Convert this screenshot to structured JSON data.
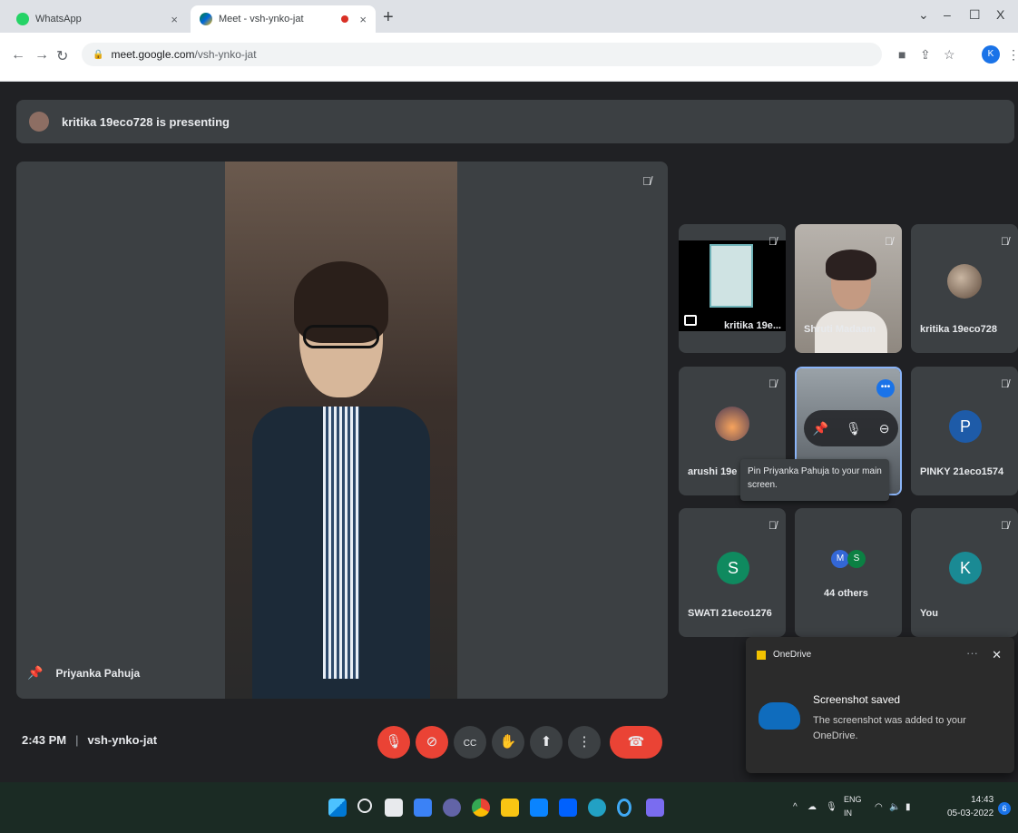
{
  "browser": {
    "tabs": [
      {
        "title": "WhatsApp",
        "close": "×"
      },
      {
        "title": "Meet - vsh-ynko-jat",
        "close": "×"
      }
    ],
    "new_tab": "+",
    "window": {
      "minimize": "–",
      "maximize": "☐",
      "close": "X",
      "tab_search": "⌄"
    },
    "address": {
      "domain": "meet.google.com",
      "path": "/vsh-ynko-jat"
    },
    "profile_letter": "K"
  },
  "meet": {
    "presenting_banner": "kritika 19eco728 is presenting",
    "main_speaker": "Priyanka Pahuja",
    "tiles": [
      {
        "name": "kritika 19e..."
      },
      {
        "name": "Shruti Madaam"
      },
      {
        "name": "kritika 19eco728"
      },
      {
        "name": "arushi 19e"
      },
      {
        "name": "PINKY 21eco1574",
        "letter": "P"
      },
      {
        "name": "SWATI 21eco1276",
        "letter": "S"
      },
      {
        "name": "44 others",
        "letters": [
          "M",
          "S"
        ]
      },
      {
        "name": "You",
        "letter": "K"
      }
    ],
    "tooltip": "Pin Priyanka Pahuja to your main screen.",
    "time": "2:43 PM",
    "meeting_code": "vsh-ynko-jat",
    "separator": "|"
  },
  "toast": {
    "app": "OneDrive",
    "title": "Screenshot saved",
    "body": "The screenshot was added to your OneDrive.",
    "more": "···",
    "close": "✕"
  },
  "taskbar": {
    "language": "ENG",
    "region": "IN",
    "time": "14:43",
    "date": "05-03-2022",
    "notifications": "6"
  },
  "colors": {
    "accent": "#1a73e8",
    "danger": "#ea4335",
    "tile_bg": "#3c4043",
    "background": "#202124"
  }
}
